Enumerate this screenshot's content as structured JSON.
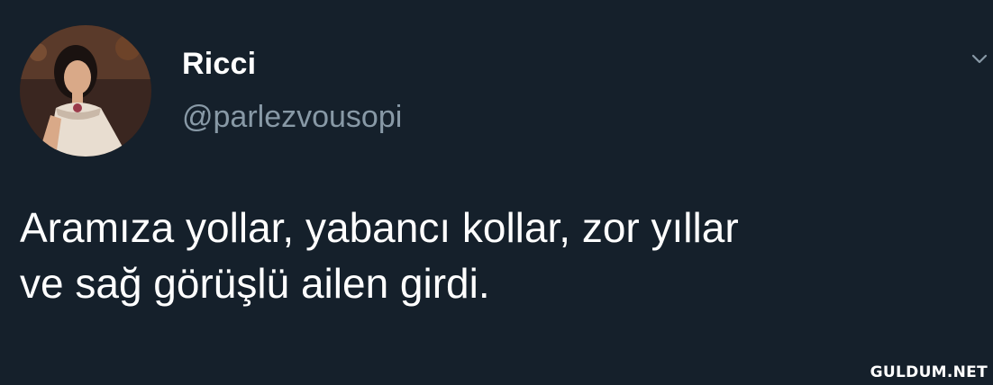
{
  "tweet": {
    "display_name": "Ricci",
    "handle": "@parlezvousopi",
    "text_line_1": "Aramıza yollar, yabancı kollar, zor yıllar",
    "text_line_2": "ve sağ görüşlü ailen girdi."
  },
  "icons": {
    "menu": "chevron-down-icon"
  },
  "watermark": "GULDUM.NET",
  "colors": {
    "background": "#15202b",
    "name": "#ffffff",
    "handle": "#8899a6",
    "text": "#ffffff"
  }
}
